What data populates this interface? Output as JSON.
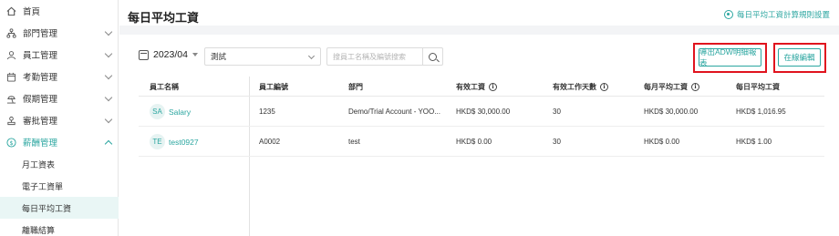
{
  "sidebar": {
    "items": [
      {
        "label": "首頁",
        "icon": "home-icon"
      },
      {
        "label": "部門管理",
        "icon": "org-chart-icon"
      },
      {
        "label": "員工管理",
        "icon": "user-icon"
      },
      {
        "label": "考勤管理",
        "icon": "calendar-check-icon"
      },
      {
        "label": "假期管理",
        "icon": "beach-icon"
      },
      {
        "label": "審批管理",
        "icon": "approval-icon"
      },
      {
        "label": "薪酬管理",
        "icon": "money-icon"
      }
    ],
    "sub_items": [
      {
        "label": "月工資表"
      },
      {
        "label": "電子工資單"
      },
      {
        "label": "每日平均工資",
        "active": true
      },
      {
        "label": "離職結算"
      }
    ]
  },
  "header": {
    "title": "每日平均工資",
    "rule_link": "每日平均工資計算規則設置"
  },
  "filters": {
    "month": "2023/04",
    "department": "測試",
    "search_placeholder": "搜員工名稱及編號搜索"
  },
  "actions": {
    "export_label": "導出ADW明細報表",
    "online_edit_label": "在線編輯"
  },
  "table": {
    "columns": [
      "員工名稱",
      "員工編號",
      "部門",
      "有效工資",
      "有效工作天數",
      "每月平均工資",
      "每日平均工資"
    ],
    "info_columns": [
      3,
      4,
      5
    ],
    "rows": [
      {
        "initials": "SA",
        "name": "Salary",
        "emp_no": "1235",
        "dept": "Demo/Trial Account - YOO...",
        "valid_wage": "HKD$ 30,000.00",
        "valid_days": "30",
        "monthly_avg": "HKD$ 30,000.00",
        "daily_avg": "HKD$ 1,016.95"
      },
      {
        "initials": "TE",
        "name": "test0927",
        "emp_no": "A0002",
        "dept": "test",
        "valid_wage": "HKD$ 0.00",
        "valid_days": "30",
        "monthly_avg": "HKD$ 0.00",
        "daily_avg": "HKD$ 1.00"
      }
    ]
  },
  "colors": {
    "accent": "#2ba6a0",
    "highlight_box": "#e0141e"
  }
}
